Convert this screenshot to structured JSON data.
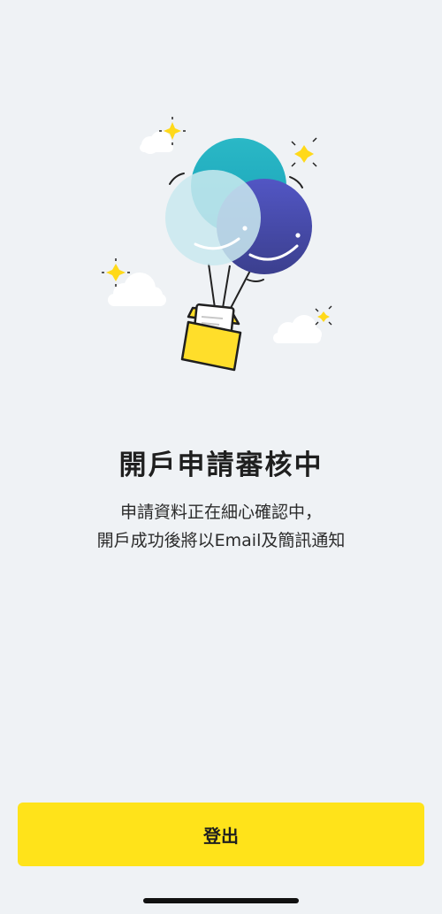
{
  "status": {
    "title": "開戶申請審核中",
    "message_line1": "申請資料正在細心確認中，",
    "message_line2": "開戶成功後將以Email及簡訊通知"
  },
  "actions": {
    "logout_label": "登出"
  },
  "illustration": {
    "icon": "balloons-envelope-icon",
    "colors": {
      "teal": "#1fb4c4",
      "light_blue": "#c9e9ef",
      "indigo": "#4a50b4",
      "yellow": "#ffde2a"
    }
  },
  "theme": {
    "background": "#eff2f5",
    "accent": "#ffe31a"
  }
}
